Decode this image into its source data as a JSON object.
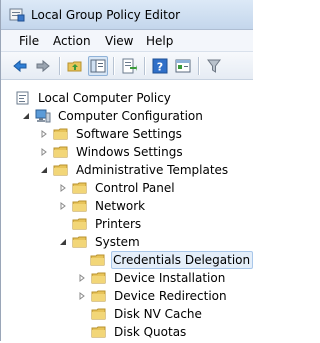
{
  "window": {
    "title": "Local Group Policy Editor"
  },
  "menu": [
    "File",
    "Action",
    "View",
    "Help"
  ],
  "toolbar": {
    "buttons": [
      "back-arrow-icon",
      "forward-arrow-icon",
      "up-folder-icon",
      "show-hide-tree-icon",
      "export-list-icon",
      "help-icon",
      "properties-icon",
      "filter-icon"
    ]
  },
  "tree": {
    "root": "Local Computer Policy",
    "computer_configuration": "Computer Configuration",
    "software_settings": "Software Settings",
    "windows_settings": "Windows Settings",
    "administrative_templates": "Administrative Templates",
    "control_panel": "Control Panel",
    "network": "Network",
    "printers": "Printers",
    "system": "System",
    "credentials_delegation": "Credentials Delegation",
    "device_installation": "Device Installation",
    "device_redirection": "Device Redirection",
    "disk_nv_cache": "Disk NV Cache",
    "disk_quotas": "Disk Quotas"
  },
  "colors": {
    "folder": "#e8c45a",
    "selection": "#e4eef9",
    "selection_border": "#a9c7ea"
  }
}
